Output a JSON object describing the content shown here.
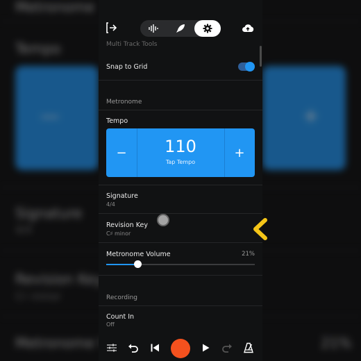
{
  "background": {
    "title_top": "Metronome",
    "tempo_label": "Tempo",
    "signature_label": "Signature",
    "signature_value": "4/4",
    "revision_key_label": "Revision Key",
    "revision_key_value": "C♯ minor",
    "metronome_volume_label": "Metronome V",
    "metronome_volume_value": "21%"
  },
  "header": {
    "icons": [
      "exit-icon",
      "waveform-icon",
      "rocket-icon",
      "gear-icon",
      "cloud-upload-icon"
    ],
    "active_tab": "settings"
  },
  "settings": {
    "cut_section_label": "Multi Track Tools",
    "snap_to_grid_label": "Snap to Grid",
    "snap_to_grid_enabled": true,
    "metronome_section": "Metronome",
    "tempo_label": "Tempo",
    "tempo_value": "110",
    "tap_tempo_label": "Tap Tempo",
    "minus_label": "−",
    "plus_label": "+",
    "signature_label": "Signature",
    "signature_value": "4/4",
    "revision_key_label": "Revision Key",
    "revision_key_value": "C♯ minor",
    "volume_label": "Metronome Volume",
    "volume_value": "21%",
    "volume_fraction": 0.21,
    "recording_section": "Recording",
    "count_in_label": "Count In",
    "count_in_value": "Off"
  },
  "transport": {
    "icons": [
      "mixer-icon",
      "undo-icon",
      "skip-back-icon",
      "record-icon",
      "play-icon",
      "redo-icon",
      "metronome-icon"
    ]
  },
  "colors": {
    "accent": "#2196f3",
    "record": "#f4511e",
    "overlay_chevron": "#f5c518"
  }
}
